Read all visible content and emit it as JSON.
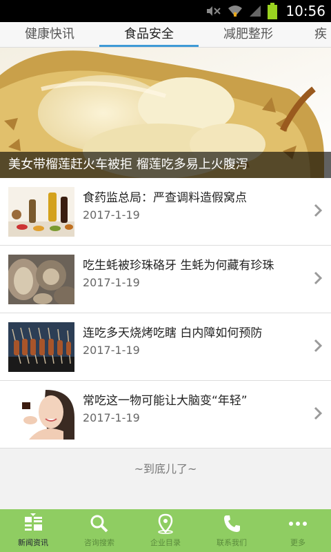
{
  "status_bar": {
    "time": "10:56",
    "icons": [
      "mute-icon",
      "wifi-icon",
      "signal-icon",
      "battery-icon"
    ]
  },
  "tabs": [
    {
      "label": "健康快讯"
    },
    {
      "label": "食品安全"
    },
    {
      "label": "减肥整形"
    },
    {
      "label": "疾"
    }
  ],
  "hero": {
    "caption": "美女带榴莲赶火车被拒 榴莲吃多易上火腹泻"
  },
  "articles": [
    {
      "title": "食药监总局：严查调料造假窝点",
      "date": "2017-1-19"
    },
    {
      "title": "吃生蚝被珍珠硌牙 生蚝为何藏有珍珠",
      "date": "2017-1-19"
    },
    {
      "title": "连吃多天烧烤吃瞎 白内障如何预防",
      "date": "2017-1-19"
    },
    {
      "title": "常吃这一物可能让大脑变“年轻”",
      "date": "2017-1-19"
    }
  ],
  "end_note": "~到底儿了~",
  "bottom_nav": [
    {
      "label": "新闻资讯",
      "icon": "news-grid-icon"
    },
    {
      "label": "咨询搜索",
      "icon": "search-icon"
    },
    {
      "label": "企业目录",
      "icon": "location-pin-icon"
    },
    {
      "label": "联系我们",
      "icon": "phone-icon"
    },
    {
      "label": "更多",
      "icon": "more-dots-icon"
    }
  ],
  "colors": {
    "accent": "#3e9ad6",
    "bottom_bar": "#8fcd62"
  }
}
